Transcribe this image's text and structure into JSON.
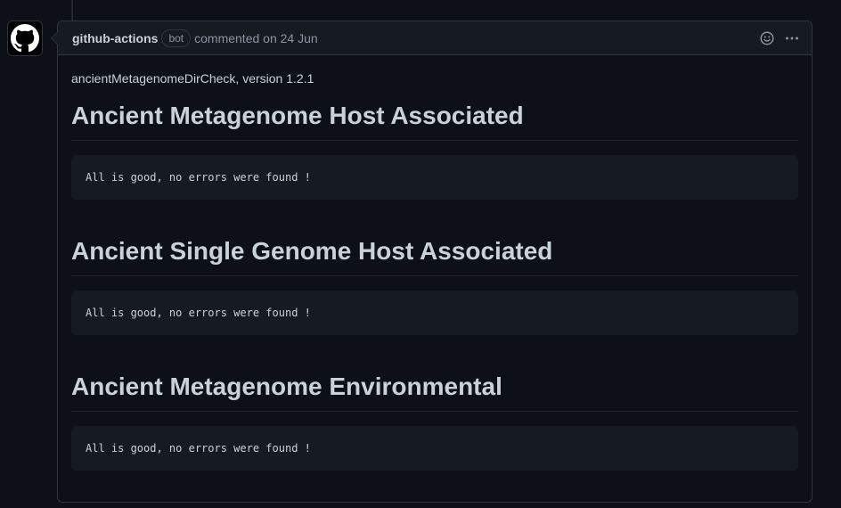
{
  "comment": {
    "author": "github-actions",
    "author_badge": "bot",
    "timestamp_text": "commented on 24 Jun",
    "body": {
      "version_line": "ancientMetagenomeDirCheck, version 1.2.1",
      "sections": [
        {
          "heading": "Ancient Metagenome Host Associated",
          "code": "All is good, no errors were found !"
        },
        {
          "heading": "Ancient Single Genome Host Associated",
          "code": "All is good, no errors were found !"
        },
        {
          "heading": "Ancient Metagenome Environmental",
          "code": "All is good, no errors were found !"
        }
      ]
    },
    "actions": {
      "reaction_icon": "smiley-icon",
      "more_icon": "kebab-horizontal-icon"
    }
  },
  "avatar": {
    "icon": "github-octocat-icon"
  },
  "colors": {
    "background": "#0d1117",
    "header_background": "#161b22",
    "border": "#30363d",
    "text": "#c9d1d9",
    "muted_text": "#8b949e"
  }
}
